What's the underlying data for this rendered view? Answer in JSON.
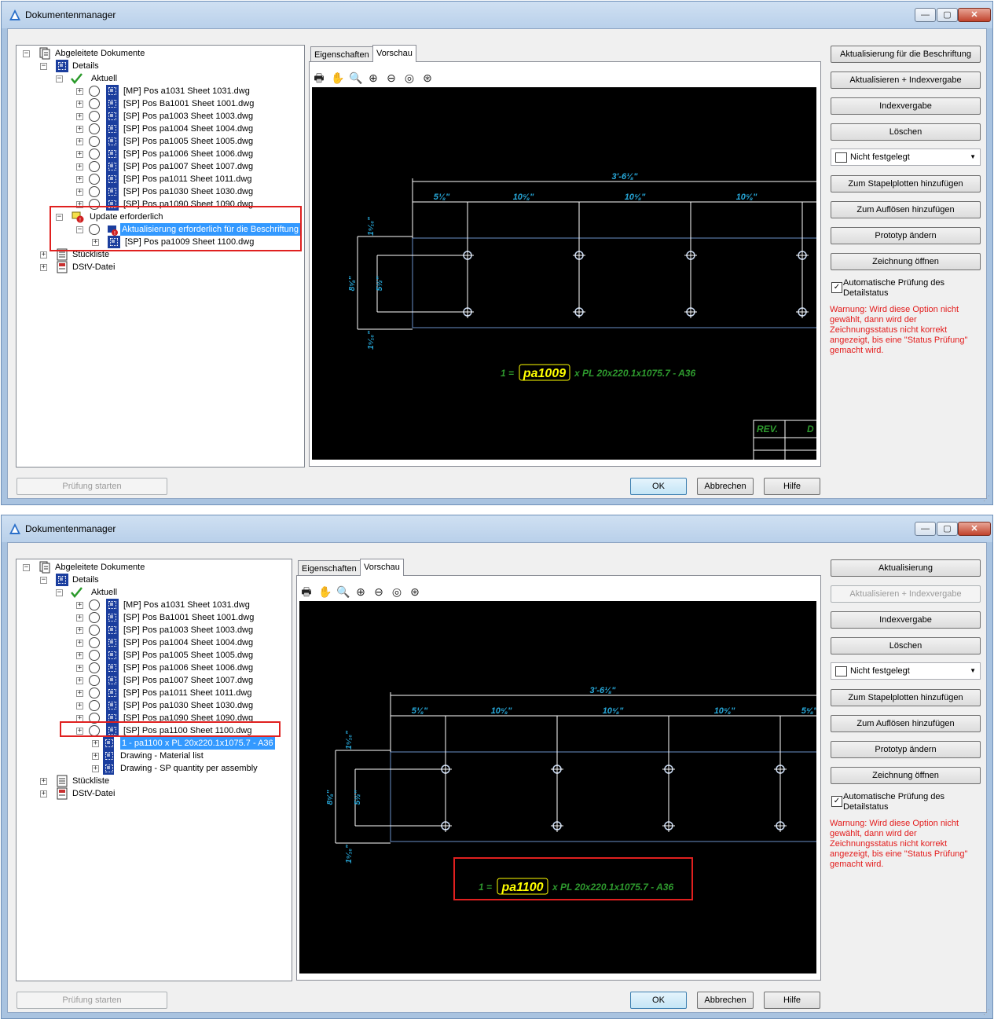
{
  "window": {
    "title": "Dokumentenmanager",
    "minimize": "—",
    "maximize": "▢",
    "close": "✕"
  },
  "tree": {
    "root": "Abgeleitete Dokumente",
    "details": "Details",
    "current": "Aktuell",
    "update_required": "Update erforderlich",
    "update_required_item": "Aktualisierung erforderlich für die Beschriftung",
    "update_sheet": "[SP] Pos pa1009 Sheet 1100.dwg",
    "parts_list": "Stückliste",
    "dstv": "DStV-Datei",
    "sheets_top": [
      "[MP] Pos a1031 Sheet 1031.dwg",
      "[SP] Pos Ba1001 Sheet 1001.dwg",
      "[SP] Pos pa1003 Sheet 1003.dwg",
      "[SP] Pos pa1004 Sheet 1004.dwg",
      "[SP] Pos pa1005 Sheet 1005.dwg",
      "[SP] Pos pa1006 Sheet 1006.dwg",
      "[SP] Pos pa1007 Sheet 1007.dwg",
      "[SP] Pos pa1011 Sheet 1011.dwg",
      "[SP] Pos pa1030 Sheet 1030.dwg",
      "[SP] Pos pa1090 Sheet 1090.dwg"
    ],
    "sheets_bottom": [
      "[MP] Pos a1031 Sheet 1031.dwg",
      "[SP] Pos Ba1001 Sheet 1001.dwg",
      "[SP] Pos pa1003 Sheet 1003.dwg",
      "[SP] Pos pa1004 Sheet 1004.dwg",
      "[SP] Pos pa1005 Sheet 1005.dwg",
      "[SP] Pos pa1006 Sheet 1006.dwg",
      "[SP] Pos pa1007 Sheet 1007.dwg",
      "[SP] Pos pa1011 Sheet 1011.dwg",
      "[SP] Pos pa1030 Sheet 1030.dwg",
      "[SP] Pos pa1090 Sheet 1090.dwg",
      "[SP] Pos pa1100 Sheet 1100.dwg"
    ],
    "children_bottom": [
      "1 - pa1100 x PL 20x220.1x1075.7 - A36",
      "Drawing - Material list",
      "Drawing - SP quantity per assembly"
    ]
  },
  "tabs": {
    "properties": "Eigenschaften",
    "preview": "Vorschau"
  },
  "toolbar_icons": [
    "print-icon",
    "pan-icon",
    "zoom-realtime-icon",
    "zoom-in-icon",
    "zoom-out-icon",
    "zoom-window-icon",
    "zoom-extents-icon"
  ],
  "toolbar_glyphs": [
    "🖶",
    "✋",
    "🔍",
    "⊕",
    "⊖",
    "◎",
    "⊛"
  ],
  "drawing": {
    "total_dim": "3'-6⅛\"",
    "dim_a": "5⅛\"",
    "dim_b": "10⅝\"",
    "dim_c": "10⅝\"",
    "dim_d": "10⅝\"",
    "dim_e": "5⅝\"",
    "v_total": "8⅝\"",
    "v_mid": "5½\"",
    "v_top": "1⁹⁄₁₆\"",
    "v_bot": "1⁹⁄₁₆\"",
    "label_prefix": "1 =",
    "label_top": "pa1009",
    "label_bottom": "pa1100",
    "label_suffix": "x PL 20x220.1x1075.7 - A36",
    "rev": "REV.",
    "rev_d": "D"
  },
  "buttons_top": {
    "update": "Aktualisierung für die Beschriftung",
    "update_index": "Aktualisieren + Indexvergabe",
    "index": "Indexvergabe",
    "delete": "Löschen",
    "batch": "Zum Stapelplotten hinzufügen",
    "resolve": "Zum Auflösen hinzufügen",
    "prototype": "Prototyp ändern",
    "open": "Zeichnung öffnen"
  },
  "buttons_bottom": {
    "update": "Aktualisierung",
    "update_index": "Aktualisieren + Indexvergabe",
    "index": "Indexvergabe",
    "delete": "Löschen",
    "batch": "Zum Stapelplotten hinzufügen",
    "resolve": "Zum Auflösen hinzufügen",
    "prototype": "Prototyp ändern",
    "open": "Zeichnung öffnen"
  },
  "combo": "Nicht festgelegt",
  "auto_check": {
    "label": "Automatische Prüfung des Detailstatus",
    "checked": "✓"
  },
  "warning": "Warnung: Wird diese Option nicht gewählt, dann wird der Zeichnungsstatus nicht korrekt angezeigt, bis eine \"Status Prüfung\" gemacht wird.",
  "footer": {
    "check": "Prüfung starten",
    "ok": "OK",
    "cancel": "Abbrechen",
    "help": "Hilfe"
  },
  "colors": {
    "highlight": "#3399ff",
    "warning": "#e31c1c",
    "dim_cyan": "#27a7d8",
    "label_green": "#2e9a2e",
    "label_yellow": "#ffff00"
  }
}
